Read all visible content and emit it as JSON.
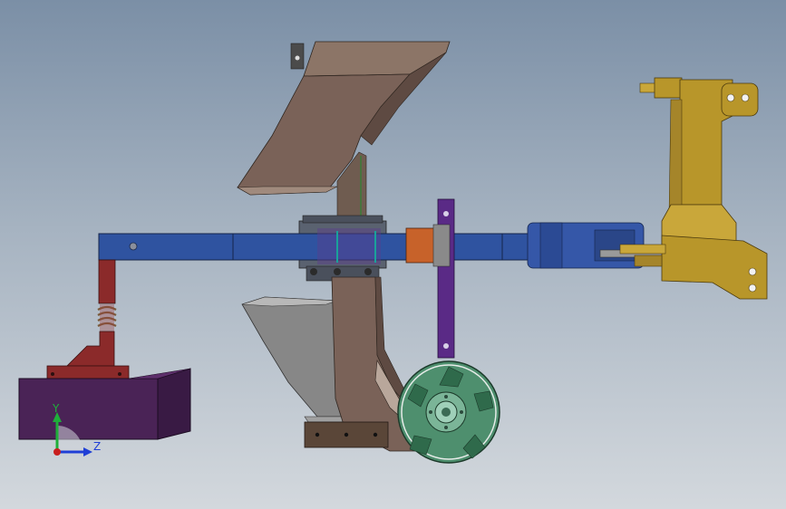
{
  "triad": {
    "y_label": "Y",
    "z_label": "Z",
    "y_color": "#1fae3a",
    "z_color": "#1f3fd6",
    "origin_color": "#c81e1e"
  },
  "colors": {
    "background_top": "#7b8fa6",
    "background_bottom": "#d3d8dd",
    "main_beam": "#2f53a0",
    "plow_body": "#7a6258",
    "moldboard": "#878787",
    "depth_wheel_bracket": "#5a2a86",
    "disc_wheel": "#4e8f6e",
    "hitch_frame": "#b8962a",
    "hydraulic_cylinder": "#3557a8",
    "skid_box": "#4a2356",
    "spring_support": "#8b2a2a"
  }
}
